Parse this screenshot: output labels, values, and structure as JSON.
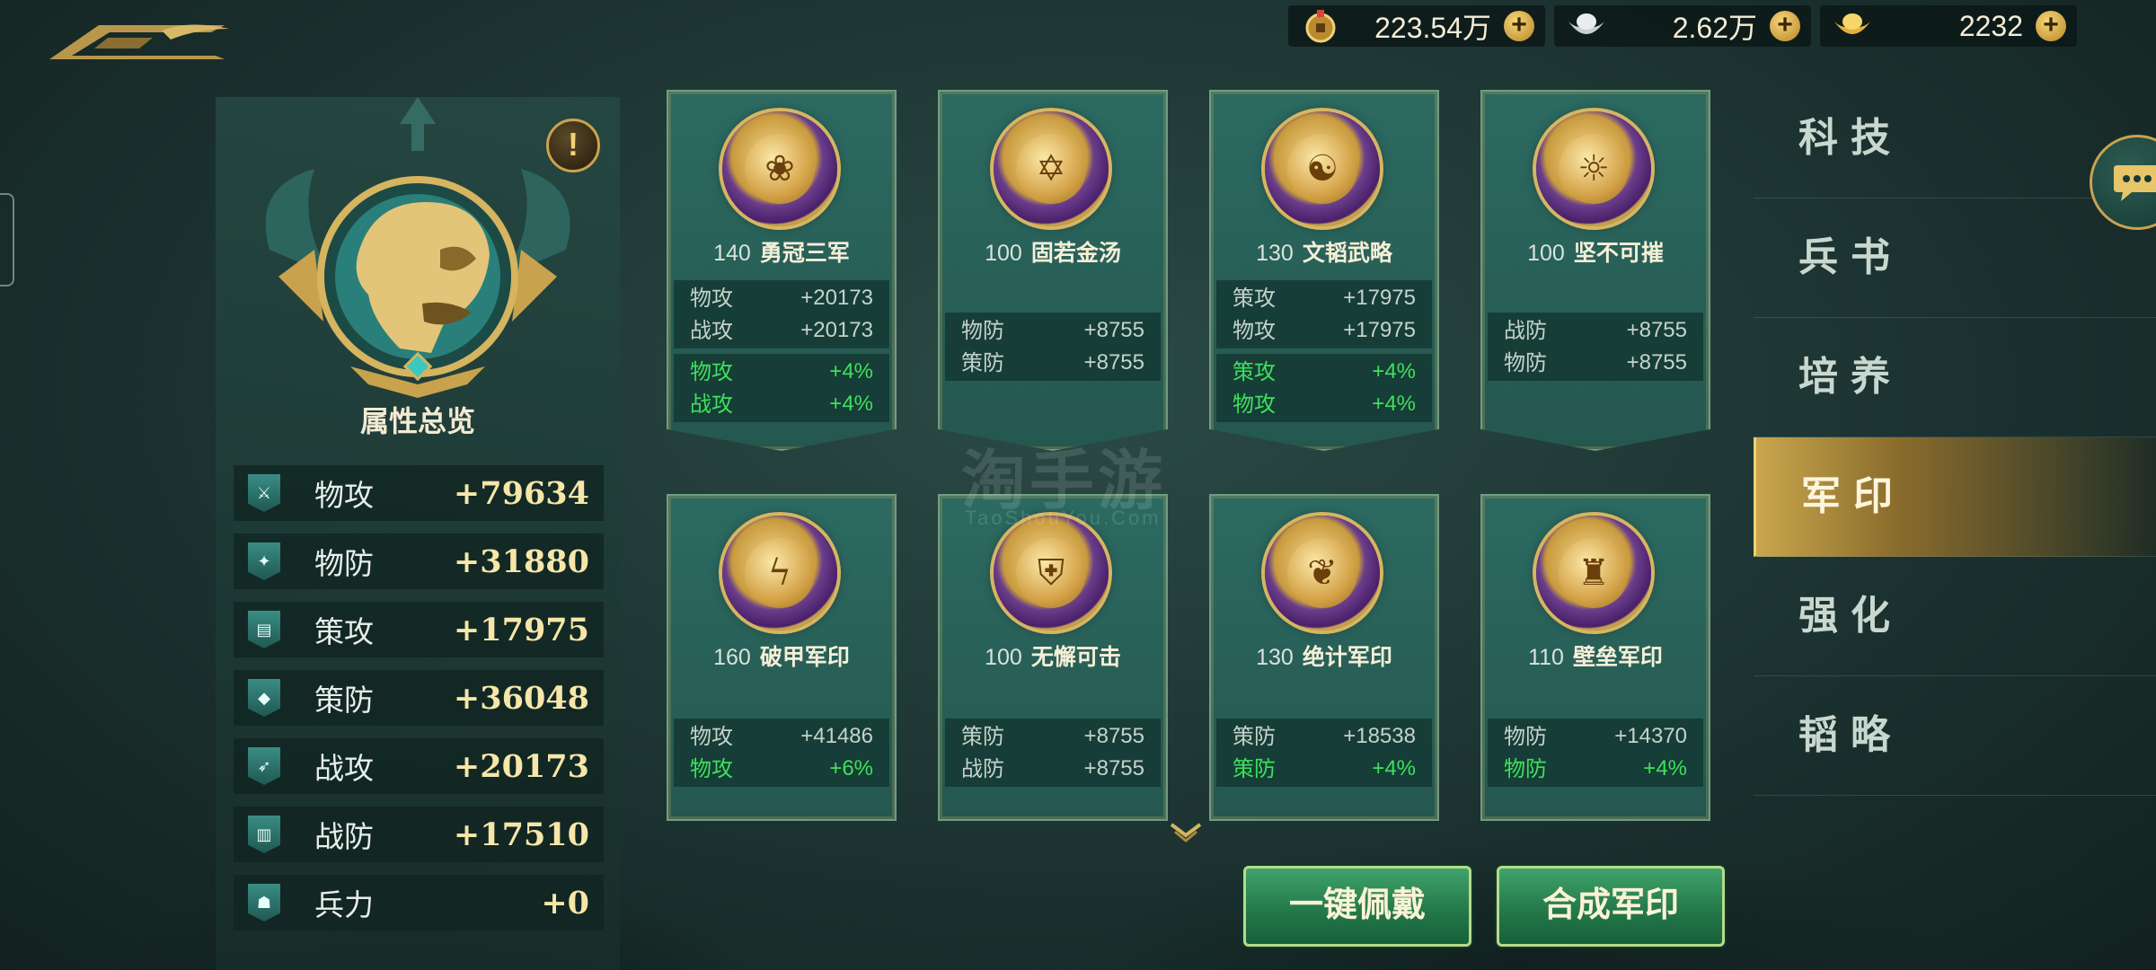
{
  "currencies": [
    {
      "icon": "copper-coin-icon",
      "value": "223.54万"
    },
    {
      "icon": "silver-ingot-icon",
      "value": "2.62万"
    },
    {
      "icon": "gold-ingot-icon",
      "value": "2232"
    }
  ],
  "overview": {
    "title": "属性总览",
    "info_symbol": "!",
    "stats": [
      {
        "name": "物攻",
        "value": "+79634"
      },
      {
        "name": "物防",
        "value": "+31880"
      },
      {
        "name": "策攻",
        "value": "+17975"
      },
      {
        "name": "策防",
        "value": "+36048"
      },
      {
        "name": "战攻",
        "value": "+20173"
      },
      {
        "name": "战防",
        "value": "+17510"
      },
      {
        "name": "兵力",
        "value": "+0"
      }
    ]
  },
  "seals": [
    {
      "level": "140",
      "name": "勇冠三军",
      "base": [
        {
          "n": "物攻",
          "v": "+20173"
        },
        {
          "n": "战攻",
          "v": "+20173"
        }
      ],
      "bonus": [
        {
          "n": "物攻",
          "v": "+4%"
        },
        {
          "n": "战攻",
          "v": "+4%"
        }
      ]
    },
    {
      "level": "100",
      "name": "固若金汤",
      "base": [
        {
          "n": "物防",
          "v": "+8755"
        },
        {
          "n": "策防",
          "v": "+8755"
        }
      ],
      "bonus": []
    },
    {
      "level": "130",
      "name": "文韬武略",
      "base": [
        {
          "n": "策攻",
          "v": "+17975"
        },
        {
          "n": "物攻",
          "v": "+17975"
        }
      ],
      "bonus": [
        {
          "n": "策攻",
          "v": "+4%"
        },
        {
          "n": "物攻",
          "v": "+4%"
        }
      ]
    },
    {
      "level": "100",
      "name": "坚不可摧",
      "base": [
        {
          "n": "战防",
          "v": "+8755"
        },
        {
          "n": "物防",
          "v": "+8755"
        }
      ],
      "bonus": []
    },
    {
      "level": "160",
      "name": "破甲军印",
      "base": [
        {
          "n": "物攻",
          "v": "+41486"
        }
      ],
      "bonus": [
        {
          "n": "物攻",
          "v": "+6%"
        }
      ]
    },
    {
      "level": "100",
      "name": "无懈可击",
      "base": [
        {
          "n": "策防",
          "v": "+8755"
        },
        {
          "n": "战防",
          "v": "+8755"
        }
      ],
      "bonus": []
    },
    {
      "level": "130",
      "name": "绝计军印",
      "base": [
        {
          "n": "策防",
          "v": "+18538"
        }
      ],
      "bonus": [
        {
          "n": "策防",
          "v": "+4%"
        }
      ]
    },
    {
      "level": "110",
      "name": "壁垒军印",
      "base": [
        {
          "n": "物防",
          "v": "+14370"
        }
      ],
      "bonus": [
        {
          "n": "物防",
          "v": "+4%"
        }
      ]
    }
  ],
  "buttons": {
    "equip_all": "一键佩戴",
    "combine": "合成军印"
  },
  "menu": [
    "科技",
    "兵书",
    "培养",
    "军印",
    "强化",
    "韬略"
  ],
  "active_menu": "军印",
  "watermark": {
    "main": "淘手游",
    "sub": "TaoShouYou.Com"
  }
}
